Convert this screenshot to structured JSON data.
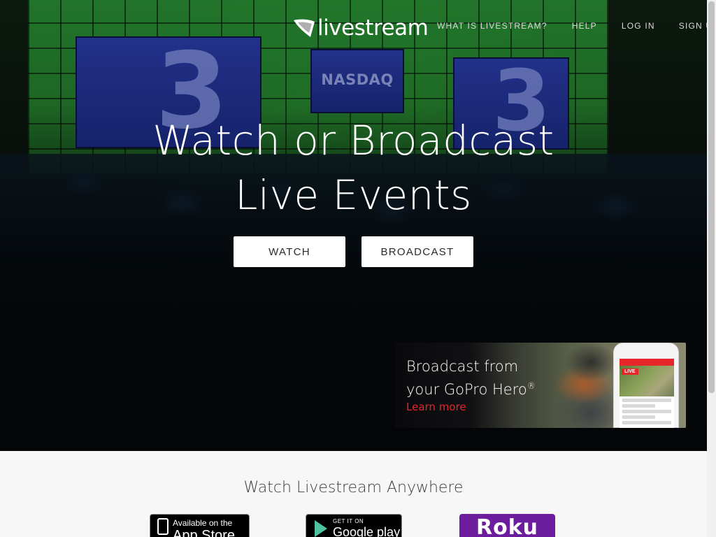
{
  "brand": {
    "name": "livestream"
  },
  "nav": {
    "what": "WHAT IS LIVESTREAM?",
    "help": "HELP",
    "login": "LOG IN",
    "signup": "SIGN UP"
  },
  "hero": {
    "headline_line1": "Watch or Broadcast",
    "headline_line2": "Live Events",
    "watch_label": "WATCH",
    "broadcast_label": "BROADCAST",
    "screen_left_number": "3",
    "screen_mid_text": "NASDAQ",
    "screen_right_number": "3"
  },
  "promo": {
    "line1": "Broadcast from",
    "line2": "your GoPro Hero",
    "registered": "®",
    "link_label": "Learn more",
    "live_badge": "LIVE"
  },
  "anywhere": {
    "title": "Watch Livestream Anywhere",
    "apple_small": "Available on the",
    "apple_big": "App Store",
    "google_small": "GET IT ON",
    "google_big": "Google play",
    "roku": "Roku"
  },
  "colors": {
    "accent_red": "#e8262a",
    "roku_purple": "#6c1d9d",
    "stage_green": "#2fa23a",
    "screen_blue": "#2a3da8"
  }
}
